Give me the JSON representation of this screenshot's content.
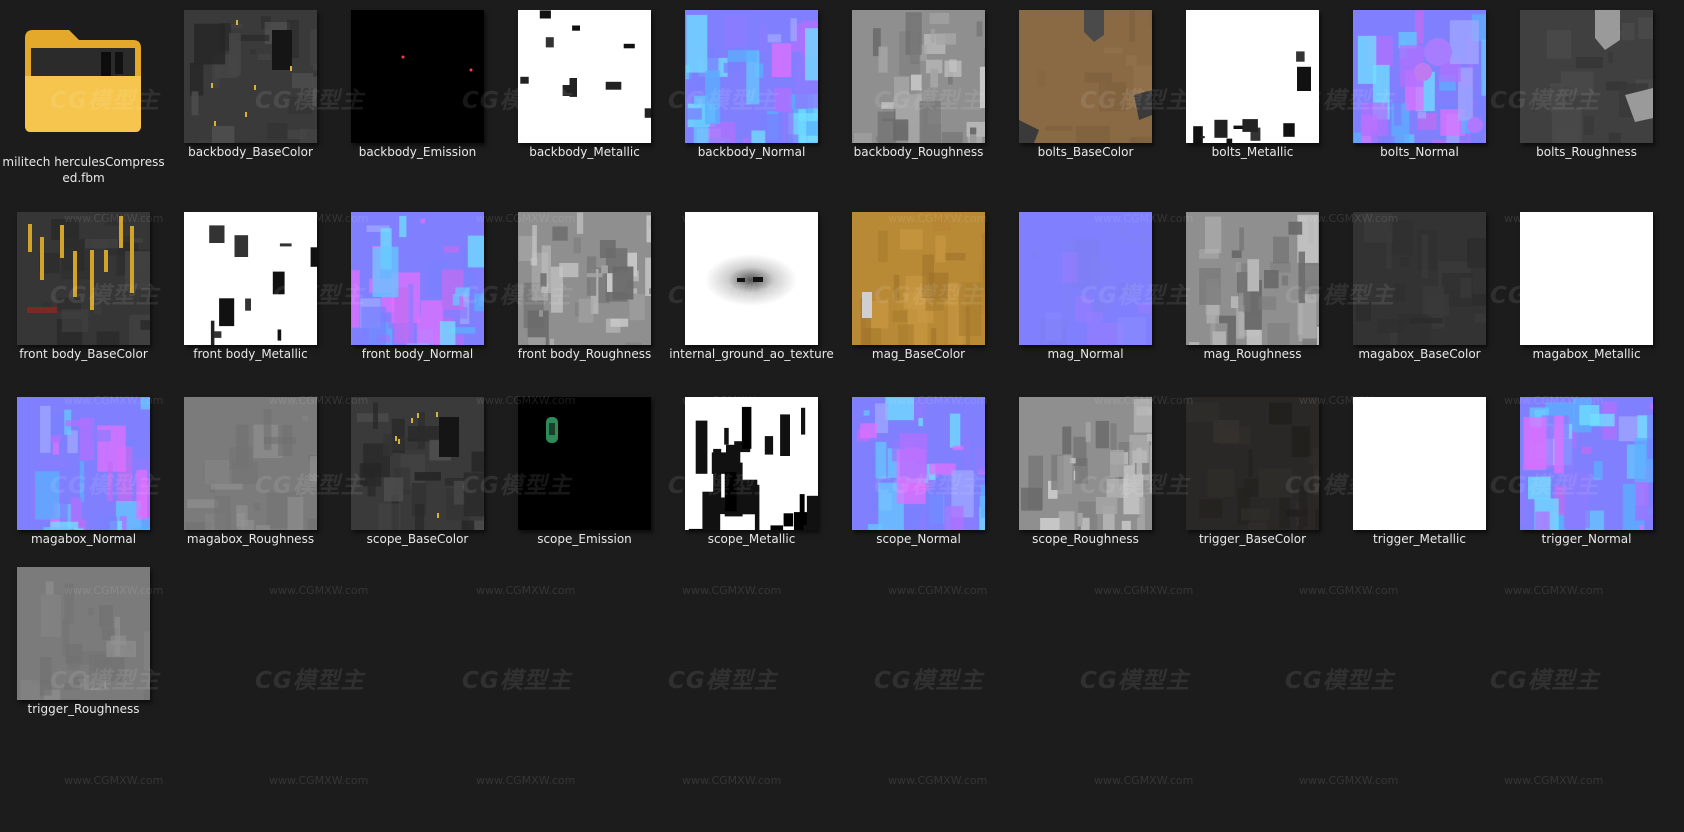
{
  "watermark": {
    "logo_text": "CG模型主",
    "url_text": "www.CGMXW.com"
  },
  "files": [
    {
      "name": "militech herculesCompressed.fbm",
      "kind": "folder",
      "icon": "folder-icon"
    },
    {
      "name": "backbody_BaseColor",
      "kind": "texture",
      "style": "basecolor-dark"
    },
    {
      "name": "backbody_Emission",
      "kind": "texture",
      "style": "emission-black"
    },
    {
      "name": "backbody_Metallic",
      "kind": "texture",
      "style": "metallic-white"
    },
    {
      "name": "backbody_Normal",
      "kind": "texture",
      "style": "normal"
    },
    {
      "name": "backbody_Roughness",
      "kind": "texture",
      "style": "roughness-light"
    },
    {
      "name": "bolts_BaseColor",
      "kind": "texture",
      "style": "basecolor-brown"
    },
    {
      "name": "bolts_Metallic",
      "kind": "texture",
      "style": "metallic-white"
    },
    {
      "name": "bolts_Normal",
      "kind": "texture",
      "style": "normal-bolts"
    },
    {
      "name": "bolts_Roughness",
      "kind": "texture",
      "style": "roughness-dark"
    },
    {
      "name": "front body_BaseColor",
      "kind": "texture",
      "style": "basecolor-yellowstripes"
    },
    {
      "name": "front body_Metallic",
      "kind": "texture",
      "style": "metallic-white"
    },
    {
      "name": "front body_Normal",
      "kind": "texture",
      "style": "normal"
    },
    {
      "name": "front body_Roughness",
      "kind": "texture",
      "style": "roughness-light"
    },
    {
      "name": "internal_ground_ao_texture",
      "kind": "texture",
      "style": "ao"
    },
    {
      "name": "mag_BaseColor",
      "kind": "texture",
      "style": "basecolor-orange"
    },
    {
      "name": "mag_Normal",
      "kind": "texture",
      "style": "normal-flat"
    },
    {
      "name": "mag_Roughness",
      "kind": "texture",
      "style": "roughness-light"
    },
    {
      "name": "magabox_BaseColor",
      "kind": "texture",
      "style": "basecolor-darkgray"
    },
    {
      "name": "magabox_Metallic",
      "kind": "texture",
      "style": "white"
    },
    {
      "name": "magabox_Normal",
      "kind": "texture",
      "style": "normal"
    },
    {
      "name": "magabox_Roughness",
      "kind": "texture",
      "style": "roughness-mid"
    },
    {
      "name": "scope_BaseColor",
      "kind": "texture",
      "style": "basecolor-dark"
    },
    {
      "name": "scope_Emission",
      "kind": "texture",
      "style": "emission-green"
    },
    {
      "name": "scope_Metallic",
      "kind": "texture",
      "style": "metallic-blocks"
    },
    {
      "name": "scope_Normal",
      "kind": "texture",
      "style": "normal"
    },
    {
      "name": "scope_Roughness",
      "kind": "texture",
      "style": "roughness-light"
    },
    {
      "name": "trigger_BaseColor",
      "kind": "texture",
      "style": "basecolor-verydark"
    },
    {
      "name": "trigger_Metallic",
      "kind": "texture",
      "style": "white"
    },
    {
      "name": "trigger_Normal",
      "kind": "texture",
      "style": "normal"
    },
    {
      "name": "trigger_Roughness",
      "kind": "texture",
      "style": "roughness-mid"
    }
  ]
}
